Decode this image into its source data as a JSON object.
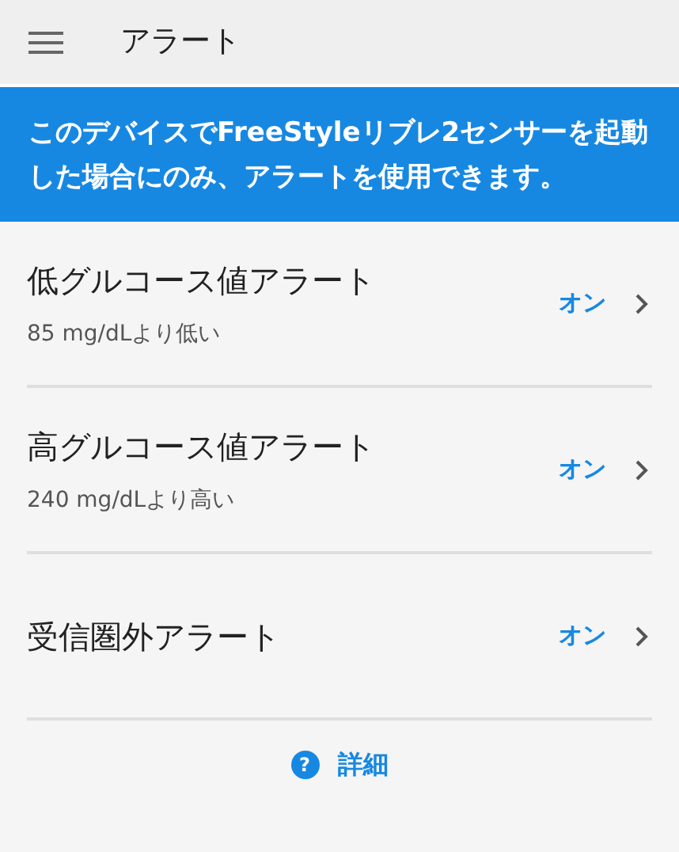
{
  "app_bar": {
    "title": "アラート"
  },
  "banner": {
    "text": "このデバイスでFreeStyleリブレ2センサーを起動した場合にのみ、アラートを使用できます。"
  },
  "alerts": [
    {
      "title": "低グルコース値アラート",
      "subtitle": "85 mg/dLより低い",
      "status": "オン"
    },
    {
      "title": "高グルコース値アラート",
      "subtitle": "240 mg/dLより高い",
      "status": "オン"
    },
    {
      "title": "受信圏外アラート",
      "status": "オン"
    }
  ],
  "details_link": {
    "icon": "?",
    "label": "詳細"
  }
}
